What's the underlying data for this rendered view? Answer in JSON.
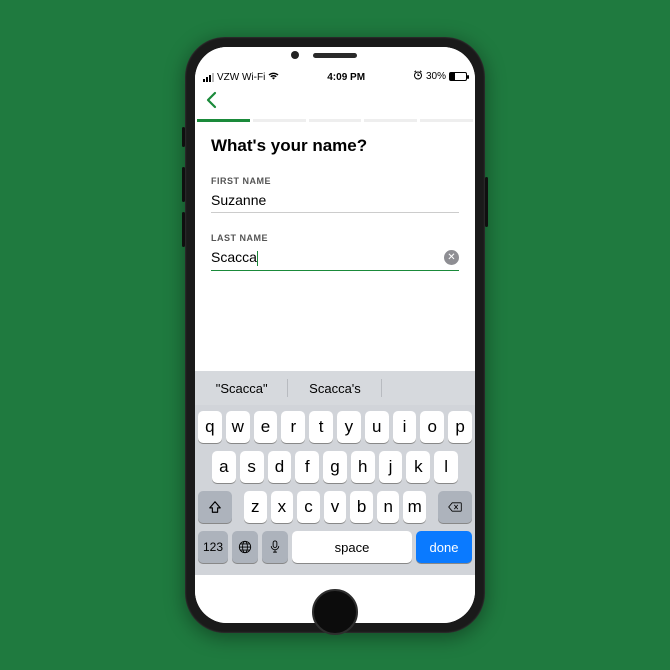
{
  "statusbar": {
    "carrier": "VZW Wi-Fi",
    "time": "4:09 PM",
    "battery_pct": "30%"
  },
  "nav": {
    "back": "‹"
  },
  "page": {
    "title": "What's your name?",
    "first_label": "FIRST NAME",
    "first_value": "Suzanne",
    "last_label": "LAST NAME",
    "last_value": "Scacca"
  },
  "keyboard": {
    "suggestions": [
      "\"Scacca\"",
      "Scacca's",
      ""
    ],
    "row1": [
      "q",
      "w",
      "e",
      "r",
      "t",
      "y",
      "u",
      "i",
      "o",
      "p"
    ],
    "row2": [
      "a",
      "s",
      "d",
      "f",
      "g",
      "h",
      "j",
      "k",
      "l"
    ],
    "row3": [
      "z",
      "x",
      "c",
      "v",
      "b",
      "n",
      "m"
    ],
    "num_key": "123",
    "space_key": "space",
    "done_key": "done"
  }
}
